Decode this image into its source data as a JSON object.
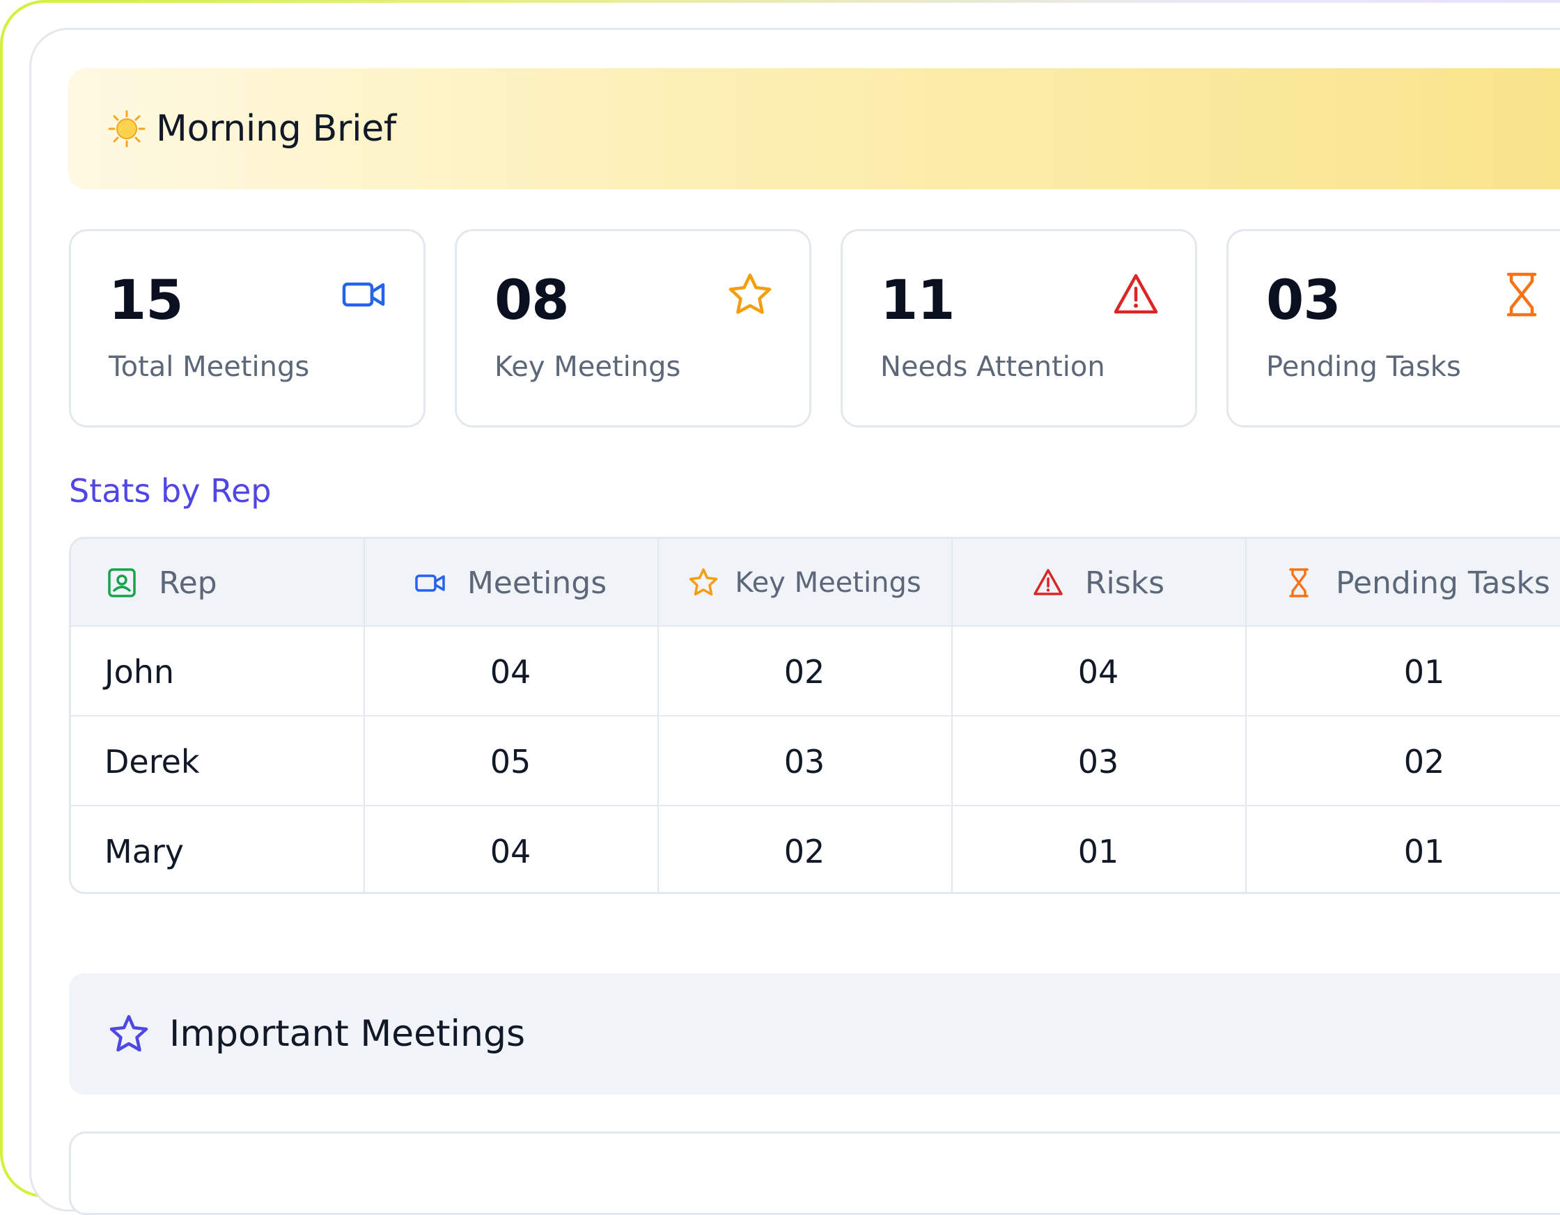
{
  "banner": {
    "title": "Morning Brief",
    "icon": "sun-icon"
  },
  "stats": [
    {
      "value": "15",
      "label": "Total Meetings",
      "icon": "video-camera-icon",
      "color": "#2563eb"
    },
    {
      "value": "08",
      "label": "Key Meetings",
      "icon": "star-icon",
      "color": "#f59e0b"
    },
    {
      "value": "11",
      "label": "Needs Attention",
      "icon": "warning-triangle-icon",
      "color": "#dc2626"
    },
    {
      "value": "03",
      "label": "Pending Tasks",
      "icon": "hourglass-icon",
      "color": "#f97316"
    }
  ],
  "section": {
    "title": "Stats by Rep"
  },
  "table": {
    "columns": [
      {
        "label": "Rep",
        "icon": "contact-badge-icon",
        "color": "#16a34a"
      },
      {
        "label": "Meetings",
        "icon": "video-camera-icon",
        "color": "#2563eb"
      },
      {
        "label": "Key Meetings",
        "icon": "star-icon",
        "color": "#f59e0b"
      },
      {
        "label": "Risks",
        "icon": "warning-triangle-icon",
        "color": "#dc2626"
      },
      {
        "label": "Pending Tasks",
        "icon": "hourglass-icon",
        "color": "#f97316"
      }
    ],
    "rows": [
      {
        "rep": "John",
        "meetings": "04",
        "key_meetings": "02",
        "risks": "04",
        "pending_tasks": "01"
      },
      {
        "rep": "Derek",
        "meetings": "05",
        "key_meetings": "03",
        "risks": "03",
        "pending_tasks": "02"
      },
      {
        "rep": "Mary",
        "meetings": "04",
        "key_meetings": "02",
        "risks": "01",
        "pending_tasks": "01"
      }
    ]
  },
  "important": {
    "title": "Important Meetings",
    "icon": "star-icon",
    "color": "#4f46e5"
  },
  "colors": {
    "accent": "#4f46e5",
    "frame_start": "#d4f03a",
    "frame_end": "#e7e0fb",
    "banner_end": "#f9e38a"
  }
}
